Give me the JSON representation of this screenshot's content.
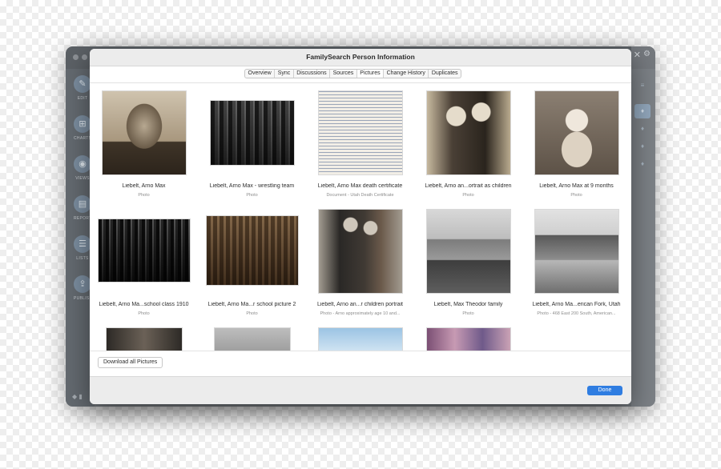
{
  "dialog": {
    "title": "FamilySearch Person Information"
  },
  "tabs": [
    {
      "label": "Overview"
    },
    {
      "label": "Sync"
    },
    {
      "label": "Discussions"
    },
    {
      "label": "Sources"
    },
    {
      "label": "Pictures",
      "selected": true
    },
    {
      "label": "Change History"
    },
    {
      "label": "Duplicates"
    }
  ],
  "sidebar": {
    "items": [
      {
        "label": "EDIT",
        "icon": "pencil-icon"
      },
      {
        "label": "CHARTS",
        "icon": "chart-icon"
      },
      {
        "label": "VIEWS",
        "icon": "eye-icon"
      },
      {
        "label": "REPORTS",
        "icon": "report-icon"
      },
      {
        "label": "LISTS",
        "icon": "list-icon"
      },
      {
        "label": "PUBLISH",
        "icon": "upload-icon"
      }
    ]
  },
  "pictures": [
    {
      "title": "Liebelt, Arno Max",
      "subtitle": "Photo"
    },
    {
      "title": "Liebelt, Arno Max - wrestling team",
      "subtitle": "Photo"
    },
    {
      "title": "Liebelt, Arno Max death certificate",
      "subtitle": "Document - Utah Death Certificate"
    },
    {
      "title": "Liebelt, Arno an...ortrait as children",
      "subtitle": "Photo"
    },
    {
      "title": "Liebelt, Arno Max at 9 months",
      "subtitle": "Photo"
    },
    {
      "title": "Liebelt, Arno Ma...school class 1910",
      "subtitle": "Photo"
    },
    {
      "title": "Liebelt, Arno Ma...r school picture 2",
      "subtitle": "Photo"
    },
    {
      "title": "Liebelt, Arno an...r children portrait",
      "subtitle": "Photo - Arno approximately age 10 and..."
    },
    {
      "title": "Liebelt, Max  Theodor family",
      "subtitle": "Photo"
    },
    {
      "title": "Liebelt, Arno Ma...erican Fork, Utah",
      "subtitle": "Photo - 468 East 200 South, American..."
    },
    {
      "title": "",
      "subtitle": ""
    },
    {
      "title": "",
      "subtitle": ""
    },
    {
      "title": "",
      "subtitle": ""
    },
    {
      "title": "",
      "subtitle": ""
    }
  ],
  "actions": {
    "download_all": "Download all Pictures",
    "done": "Done"
  },
  "colors": {
    "accent": "#2f7de1",
    "sepia": "#8a7a66",
    "window_bg": "#6f7479"
  }
}
